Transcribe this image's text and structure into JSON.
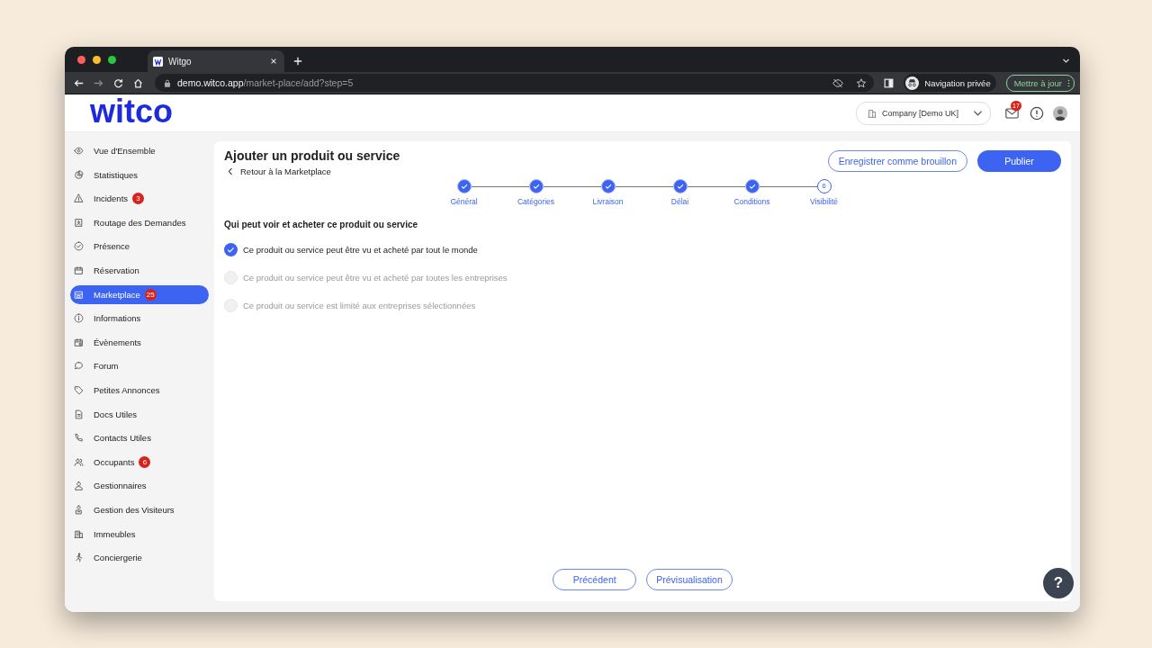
{
  "browser": {
    "tab_title": "Witgo",
    "url_host": "demo.witco.app",
    "url_path": "/market-place/add?step=5",
    "profile_label": "Navigation privée",
    "update_button": "Mettre à jour"
  },
  "header": {
    "logo": "witco",
    "company": "Company [Demo UK]",
    "mail_badge": "17"
  },
  "sidebar": {
    "items": [
      {
        "label": "Vue d'Ensemble",
        "selected": false
      },
      {
        "label": "Statistiques",
        "selected": false
      },
      {
        "label": "Incidents",
        "badge": "3",
        "selected": false
      },
      {
        "label": "Routage des Demandes",
        "selected": false
      },
      {
        "label": "Présence",
        "selected": false
      },
      {
        "label": "Réservation",
        "selected": false
      },
      {
        "label": "Marketplace",
        "badge": "25",
        "selected": true
      },
      {
        "label": "Informations",
        "selected": false
      },
      {
        "label": "Évènements",
        "selected": false
      },
      {
        "label": "Forum",
        "selected": false
      },
      {
        "label": "Petites Annonces",
        "selected": false
      },
      {
        "label": "Docs Utiles",
        "selected": false
      },
      {
        "label": "Contacts Utiles",
        "selected": false
      },
      {
        "label": "Occupants",
        "badge": "6",
        "selected": false
      },
      {
        "label": "Gestionnaires",
        "selected": false
      },
      {
        "label": "Gestion des Visiteurs",
        "selected": false
      },
      {
        "label": "Immeubles",
        "selected": false
      },
      {
        "label": "Conciergerie",
        "selected": false
      }
    ]
  },
  "page": {
    "title": "Ajouter un produit ou service",
    "back_link": "Retour à la Marketplace",
    "draft_button": "Enregistrer comme brouillon",
    "publish_button": "Publier",
    "steps": [
      {
        "label": "Général",
        "done": true
      },
      {
        "label": "Catégories",
        "done": true
      },
      {
        "label": "Livraison",
        "done": true
      },
      {
        "label": "Délai",
        "done": true
      },
      {
        "label": "Conditions",
        "done": true
      },
      {
        "label": "Visibilité",
        "done": false,
        "number": "6"
      }
    ],
    "question": "Qui peut voir et acheter ce produit ou service",
    "options": [
      {
        "label": "Ce produit ou service peut être vu et acheté par tout le monde",
        "selected": true
      },
      {
        "label": "Ce produit ou service peut être vu et acheté par toutes les entreprises",
        "selected": false
      },
      {
        "label": "Ce produit ou service est limité aux entreprises sélectionnées",
        "selected": false
      }
    ],
    "previous_button": "Précédent",
    "preview_button": "Prévisualisation",
    "help_button": "?"
  }
}
